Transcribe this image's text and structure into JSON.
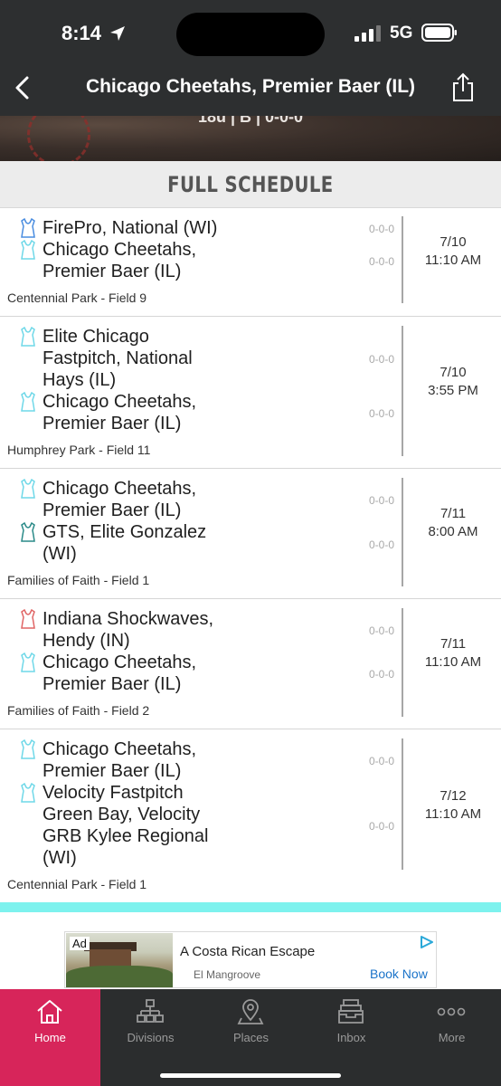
{
  "status_bar": {
    "time": "8:14",
    "network": "5G"
  },
  "header": {
    "title": "Chicago Cheetahs, Premier Baer (IL)"
  },
  "hero": {
    "text": "18u | B | 0-0-0"
  },
  "section": {
    "title": "FULL SCHEDULE"
  },
  "colors": {
    "accent": "#d7255a",
    "teal": "#7df2ee",
    "jersey_light": "#6fd8e8",
    "jersey_blue": "#4a8de0",
    "jersey_dark_teal": "#2a8a88",
    "jersey_red": "#e06565"
  },
  "games": [
    {
      "team1": {
        "name": "FirePro, National (WI)",
        "record": "0-0-0",
        "jersey_icon": "jersey-blue-icon"
      },
      "team2": {
        "name": "Chicago Cheetahs, Premier Baer (IL)",
        "record": "0-0-0",
        "jersey_icon": "jersey-light-icon"
      },
      "date": "7/10",
      "time": "11:10 AM",
      "venue": "Centennial Park - Field 9"
    },
    {
      "team1": {
        "name": "Elite Chicago Fastpitch, National Hays (IL)",
        "record": "0-0-0",
        "jersey_icon": "jersey-light-icon"
      },
      "team2": {
        "name": "Chicago Cheetahs, Premier Baer (IL)",
        "record": "0-0-0",
        "jersey_icon": "jersey-light-icon"
      },
      "date": "7/10",
      "time": "3:55 PM",
      "venue": "Humphrey Park - Field 11"
    },
    {
      "team1": {
        "name": "Chicago Cheetahs, Premier Baer (IL)",
        "record": "0-0-0",
        "jersey_icon": "jersey-light-icon"
      },
      "team2": {
        "name": "GTS, Elite Gonzalez (WI)",
        "record": "0-0-0",
        "jersey_icon": "jersey-dark-teal-icon"
      },
      "date": "7/11",
      "time": "8:00 AM",
      "venue": "Families of Faith - Field 1"
    },
    {
      "team1": {
        "name": "Indiana Shockwaves, Hendy (IN)",
        "record": "0-0-0",
        "jersey_icon": "jersey-red-icon"
      },
      "team2": {
        "name": "Chicago Cheetahs, Premier Baer (IL)",
        "record": "0-0-0",
        "jersey_icon": "jersey-light-icon"
      },
      "date": "7/11",
      "time": "11:10 AM",
      "venue": "Families of Faith - Field 2"
    },
    {
      "team1": {
        "name": "Chicago Cheetahs, Premier Baer (IL)",
        "record": "0-0-0",
        "jersey_icon": "jersey-light-icon"
      },
      "team2": {
        "name": "Velocity Fastpitch Green Bay, Velocity GRB  Kylee Regional (WI)",
        "record": "0-0-0",
        "jersey_icon": "jersey-light-icon"
      },
      "date": "7/12",
      "time": "11:10 AM",
      "venue": "Centennial Park - Field 1"
    }
  ],
  "ad": {
    "badge": "Ad",
    "title": "A Costa Rican Escape",
    "advertiser": "El Mangroove",
    "cta": "Book Now"
  },
  "tabs": [
    {
      "label": "Home",
      "icon": "home-icon",
      "active": true
    },
    {
      "label": "Divisions",
      "icon": "divisions-icon",
      "active": false
    },
    {
      "label": "Places",
      "icon": "map-pin-icon",
      "active": false
    },
    {
      "label": "Inbox",
      "icon": "inbox-icon",
      "active": false
    },
    {
      "label": "More",
      "icon": "more-icon",
      "active": false
    }
  ]
}
